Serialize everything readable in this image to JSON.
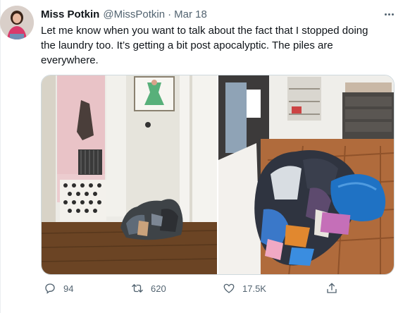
{
  "tweet": {
    "author_name": "Miss Potkin",
    "handle": "@MissPotkin",
    "separator": "·",
    "date": "Mar 18",
    "text_lines": [
      "Let me know when you want to talk about the fact that I stopped doing",
      "the laundry too. It’s getting a bit post apocalyptic. The piles are",
      "everywhere."
    ]
  },
  "actions": {
    "reply_count": "94",
    "retweet_count": "620",
    "like_count": "17.5K"
  },
  "colors": {
    "text": "#0f1419",
    "secondary": "#536471",
    "border": "#cfd9de"
  },
  "icons": [
    "more-icon",
    "reply-icon",
    "retweet-icon",
    "like-icon",
    "share-icon"
  ]
}
